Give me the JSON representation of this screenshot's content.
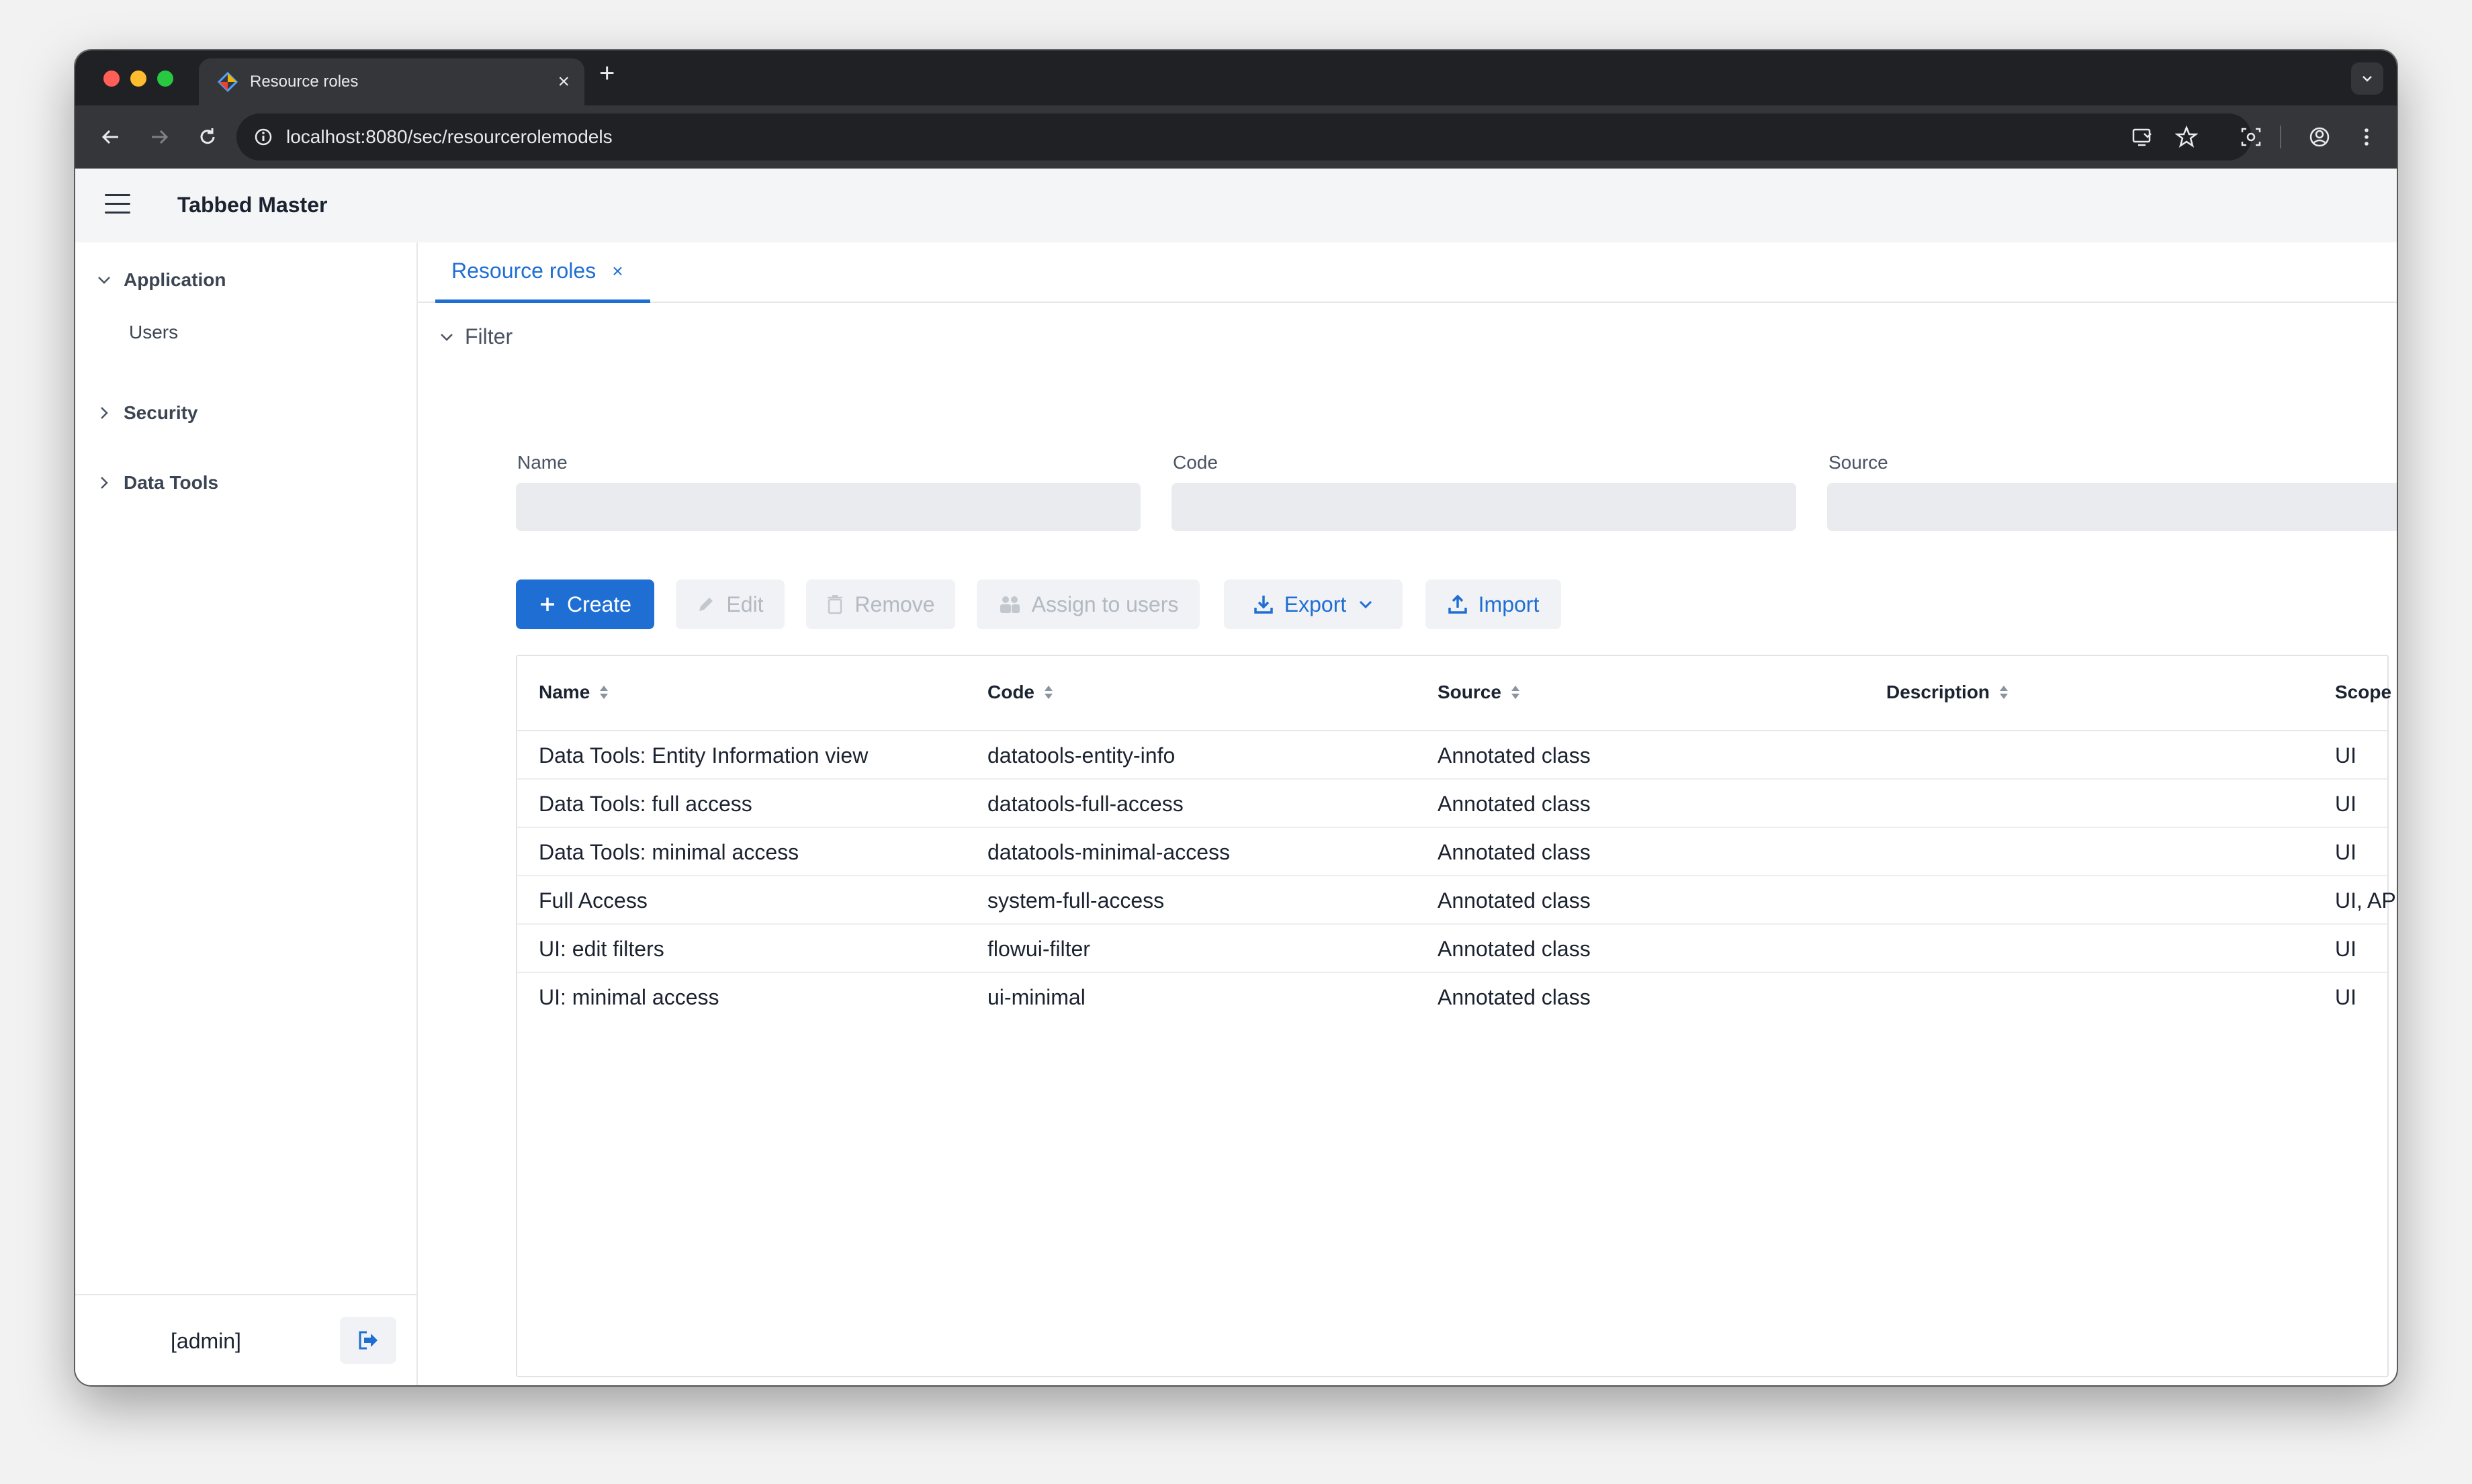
{
  "browser": {
    "tab_title": "Resource roles",
    "url": "localhost:8080/sec/resourcerolemodels"
  },
  "app": {
    "title": "Tabbed Master"
  },
  "sidebar": {
    "groups": [
      {
        "label": "Application",
        "expanded": true,
        "items": [
          {
            "label": "Users"
          }
        ]
      },
      {
        "label": "Security",
        "expanded": false
      },
      {
        "label": "Data Tools",
        "expanded": false
      }
    ],
    "user": "[admin]"
  },
  "main": {
    "tab_label": "Resource roles",
    "tab_close": "×",
    "filter": {
      "label": "Filter",
      "name_label": "Name",
      "code_label": "Code",
      "source_label": "Source",
      "name_value": "",
      "code_value": "",
      "source_value": ""
    },
    "actions": {
      "create": "Create",
      "edit": "Edit",
      "remove": "Remove",
      "assign": "Assign to users",
      "export": "Export",
      "import": "Import"
    },
    "grid": {
      "columns": [
        "Name",
        "Code",
        "Source",
        "Description",
        "Scope"
      ],
      "rows": [
        [
          "Data Tools: Entity Information view",
          "datatools-entity-info",
          "Annotated class",
          "",
          "UI"
        ],
        [
          "Data Tools: full access",
          "datatools-full-access",
          "Annotated class",
          "",
          "UI"
        ],
        [
          "Data Tools: minimal access",
          "datatools-minimal-access",
          "Annotated class",
          "",
          "UI"
        ],
        [
          "Full Access",
          "system-full-access",
          "Annotated class",
          "",
          "UI, API"
        ],
        [
          "UI: edit filters",
          "flowui-filter",
          "Annotated class",
          "",
          "UI"
        ],
        [
          "UI: minimal access",
          "ui-minimal",
          "Annotated class",
          "",
          "UI"
        ]
      ]
    }
  },
  "colors": {
    "accent": "#1f6ed4",
    "chrome_dark": "#202124",
    "chrome_toolbar": "#35363a"
  }
}
